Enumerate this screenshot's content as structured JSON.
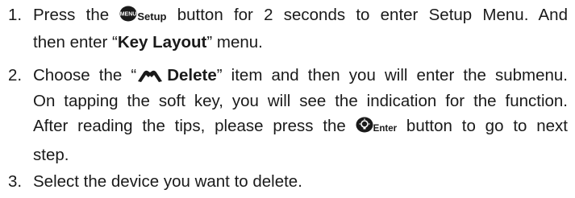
{
  "steps": [
    {
      "number": "1.",
      "before_icon": "Press the",
      "icon": "menu-button-icon",
      "icon_text": "MENU",
      "button_label": "Setup",
      "after_icon": "button for 2 seconds to enter Setup Menu. And",
      "line2_pre": "then enter “",
      "line2_bold": "Key Layout",
      "line2_post": "” menu."
    },
    {
      "number": "2.",
      "line1_pre": "Choose the “",
      "line1_icon": "delete-icon",
      "line1_bold": "Delete",
      "line1_post": "” item and then you will enter the submenu.",
      "line2": "On tapping the soft key, you will see the indication for the function.",
      "line3_pre": "After reading the tips, please press the",
      "line3_icon": "enter-button-icon",
      "line3_button_label": "Enter",
      "line3_post": "button to go to next",
      "line4": "step."
    },
    {
      "number": "3.",
      "text": "Select the device you want to delete."
    }
  ]
}
